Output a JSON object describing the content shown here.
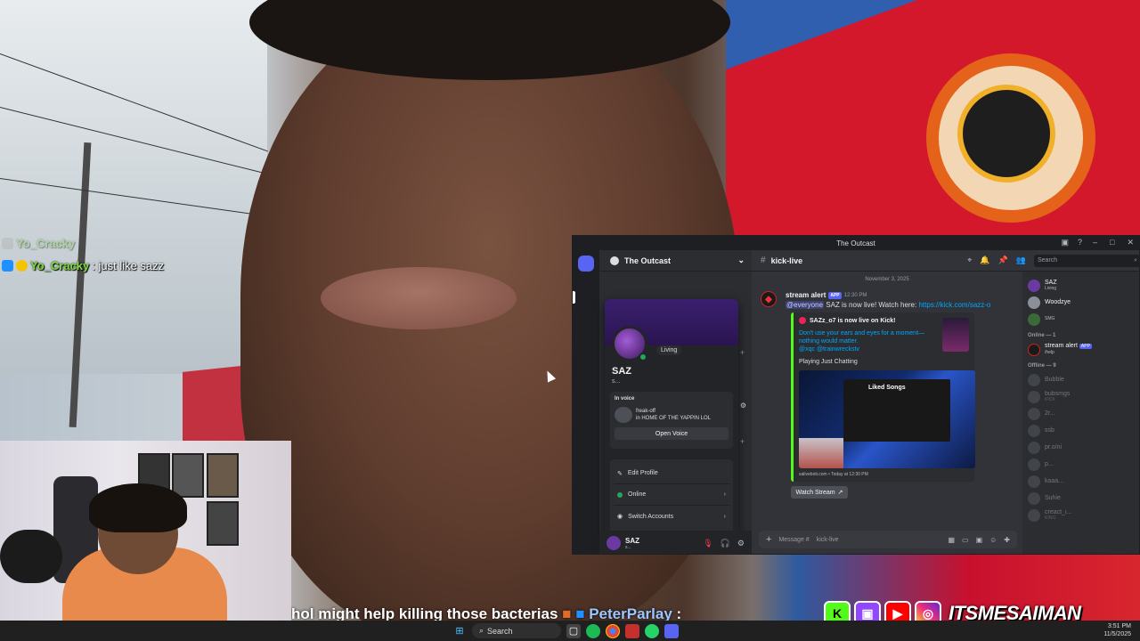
{
  "stream_chat": {
    "faded_user": "Yo_Cracky",
    "user": "Yo_Cracky",
    "message": ": just like sazz"
  },
  "ticker": {
    "prefix": "hol might help killing those bacterias",
    "name": "PeterParlay",
    "suffix": ":"
  },
  "socials": {
    "handle": "ITSMESAIMAN"
  },
  "taskbar": {
    "search_label": "Search",
    "time": "3:51 PM",
    "date": "11/5/2025"
  },
  "discord": {
    "window_title": "The Outcast",
    "server_name": "The Outcast",
    "channel_name": "kick-live",
    "search_placeholder": "Search",
    "profile": {
      "status_note": "Living",
      "name": "SAZ",
      "sub": "s...",
      "in_voice_label": "In voice",
      "voice_channel": "freak-off",
      "voice_server": "in HOME OF THE YAPPIN LOL",
      "open_voice": "Open Voice",
      "edit_profile": "Edit Profile",
      "online": "Online",
      "switch_accounts": "Switch Accounts"
    },
    "user_panel": {
      "name": "SAZ",
      "sub": "s..."
    },
    "date_divider": "November 3, 2025",
    "message": {
      "author": "stream alert",
      "badge": "APP",
      "time": "12:30 PM",
      "mention": "@everyone",
      "text": "SAZ is now live! Watch here:",
      "link": "https://kick.com/sazz-o",
      "embed_author": "SAZz_o7 is now live on Kick!",
      "embed_desc": "Don't use your ears and eyes for a moment—nothing would matter.",
      "embed_mentions": "@xqc @trainwreckstv",
      "embed_playing": "Playing Just Chatting",
      "embed_image_title": "Liked Songs",
      "embed_footer": "saliveboti.com • Today at 12:30 PM",
      "watch_button": "Watch Stream"
    },
    "composer_placeholder": "Message #",
    "composer_channel": "kick-live",
    "members": {
      "top": [
        {
          "name": "SAZ",
          "status": "Living"
        },
        {
          "name": "Woodzye",
          "status": ""
        },
        {
          "name": "",
          "status": "SMG"
        }
      ],
      "online_header": "Online — 1",
      "online": [
        {
          "name": "stream alert",
          "badge": "APP",
          "status": "/help"
        }
      ],
      "offline_header": "Offline — 9",
      "offline": [
        {
          "name": "Bubble",
          "status": ""
        },
        {
          "name": "bubsmgs",
          "status": "KICK"
        },
        {
          "name": "2r...",
          "status": ""
        },
        {
          "name": "ssb",
          "status": ""
        },
        {
          "name": "pr.o/ni",
          "status": ""
        },
        {
          "name": "p...",
          "status": ""
        },
        {
          "name": "kaaa...",
          "status": ""
        },
        {
          "name": "Suhie",
          "status": ""
        },
        {
          "name": "creact_i...",
          "status": "KING"
        }
      ]
    }
  },
  "colors": {
    "kick_green": "#53fc18",
    "discord_blurple": "#5865f2",
    "online_green": "#23a55a"
  }
}
